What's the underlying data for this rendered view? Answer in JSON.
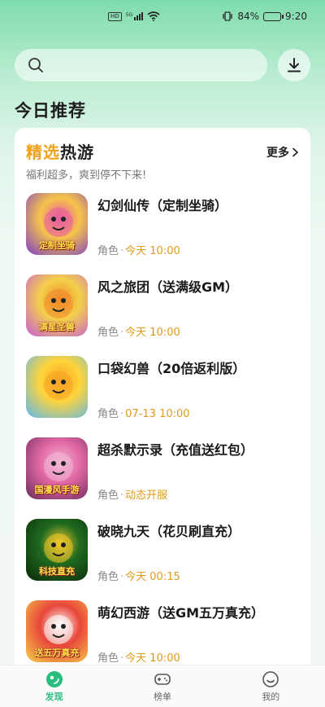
{
  "status_bar": {
    "hd": "HD",
    "signal": "5G",
    "battery_percent": "84%",
    "battery_level": 0.84,
    "time": "9:20"
  },
  "search": {
    "placeholder": ""
  },
  "section_title": "今日推荐",
  "card": {
    "title_accent": "精选",
    "title_rest": "热游",
    "subtitle": "福利超多，爽到停不下来!",
    "more_label": "更多"
  },
  "games": [
    {
      "name": "幻剑仙传（定制坐骑）",
      "category": "角色",
      "time": "今天 10:00",
      "icon_text": "定制坐骑",
      "icon_colors": [
        "#f6c34a",
        "#7a3dc8",
        "#e85ca0"
      ]
    },
    {
      "name": "风之旅团（送满级GM）",
      "category": "角色",
      "time": "今天 10:00",
      "icon_text": "满星圣兽",
      "icon_colors": [
        "#f3d04a",
        "#c75bd8",
        "#f08a2a"
      ]
    },
    {
      "name": "口袋幻兽（20倍返利版）",
      "category": "角色",
      "time": "07-13 10:00",
      "icon_text": "",
      "icon_colors": [
        "#ffd43a",
        "#5ab7f0",
        "#f7a324"
      ]
    },
    {
      "name": "超杀默示录（充值送红包）",
      "category": "角色",
      "time": "动态开服",
      "icon_text": "国漫风手游",
      "icon_colors": [
        "#e36aa6",
        "#6a2a5a",
        "#f3b6d4"
      ]
    },
    {
      "name": "破晓九天（花贝刷直充）",
      "category": "角色",
      "time": "今天 00:15",
      "icon_text": "科技直充",
      "icon_colors": [
        "#1f6a1f",
        "#0a2a0a",
        "#f3c92a"
      ]
    },
    {
      "name": "萌幻西游（送GM五万真充）",
      "category": "角色",
      "time": "今天 10:00",
      "icon_text": "送五万真充",
      "icon_colors": [
        "#e8463a",
        "#f6d34a",
        "#ffffff"
      ]
    }
  ],
  "bottom_nav": [
    {
      "label": "发现",
      "icon": "discover-icon",
      "active": true
    },
    {
      "label": "榜单",
      "icon": "gamepad-icon",
      "active": false
    },
    {
      "label": "我的",
      "icon": "smiley-icon",
      "active": false
    }
  ],
  "colors": {
    "accent": "#f0a21a",
    "nav_active": "#2bbd7e",
    "bg_top": "#7fdcae"
  }
}
